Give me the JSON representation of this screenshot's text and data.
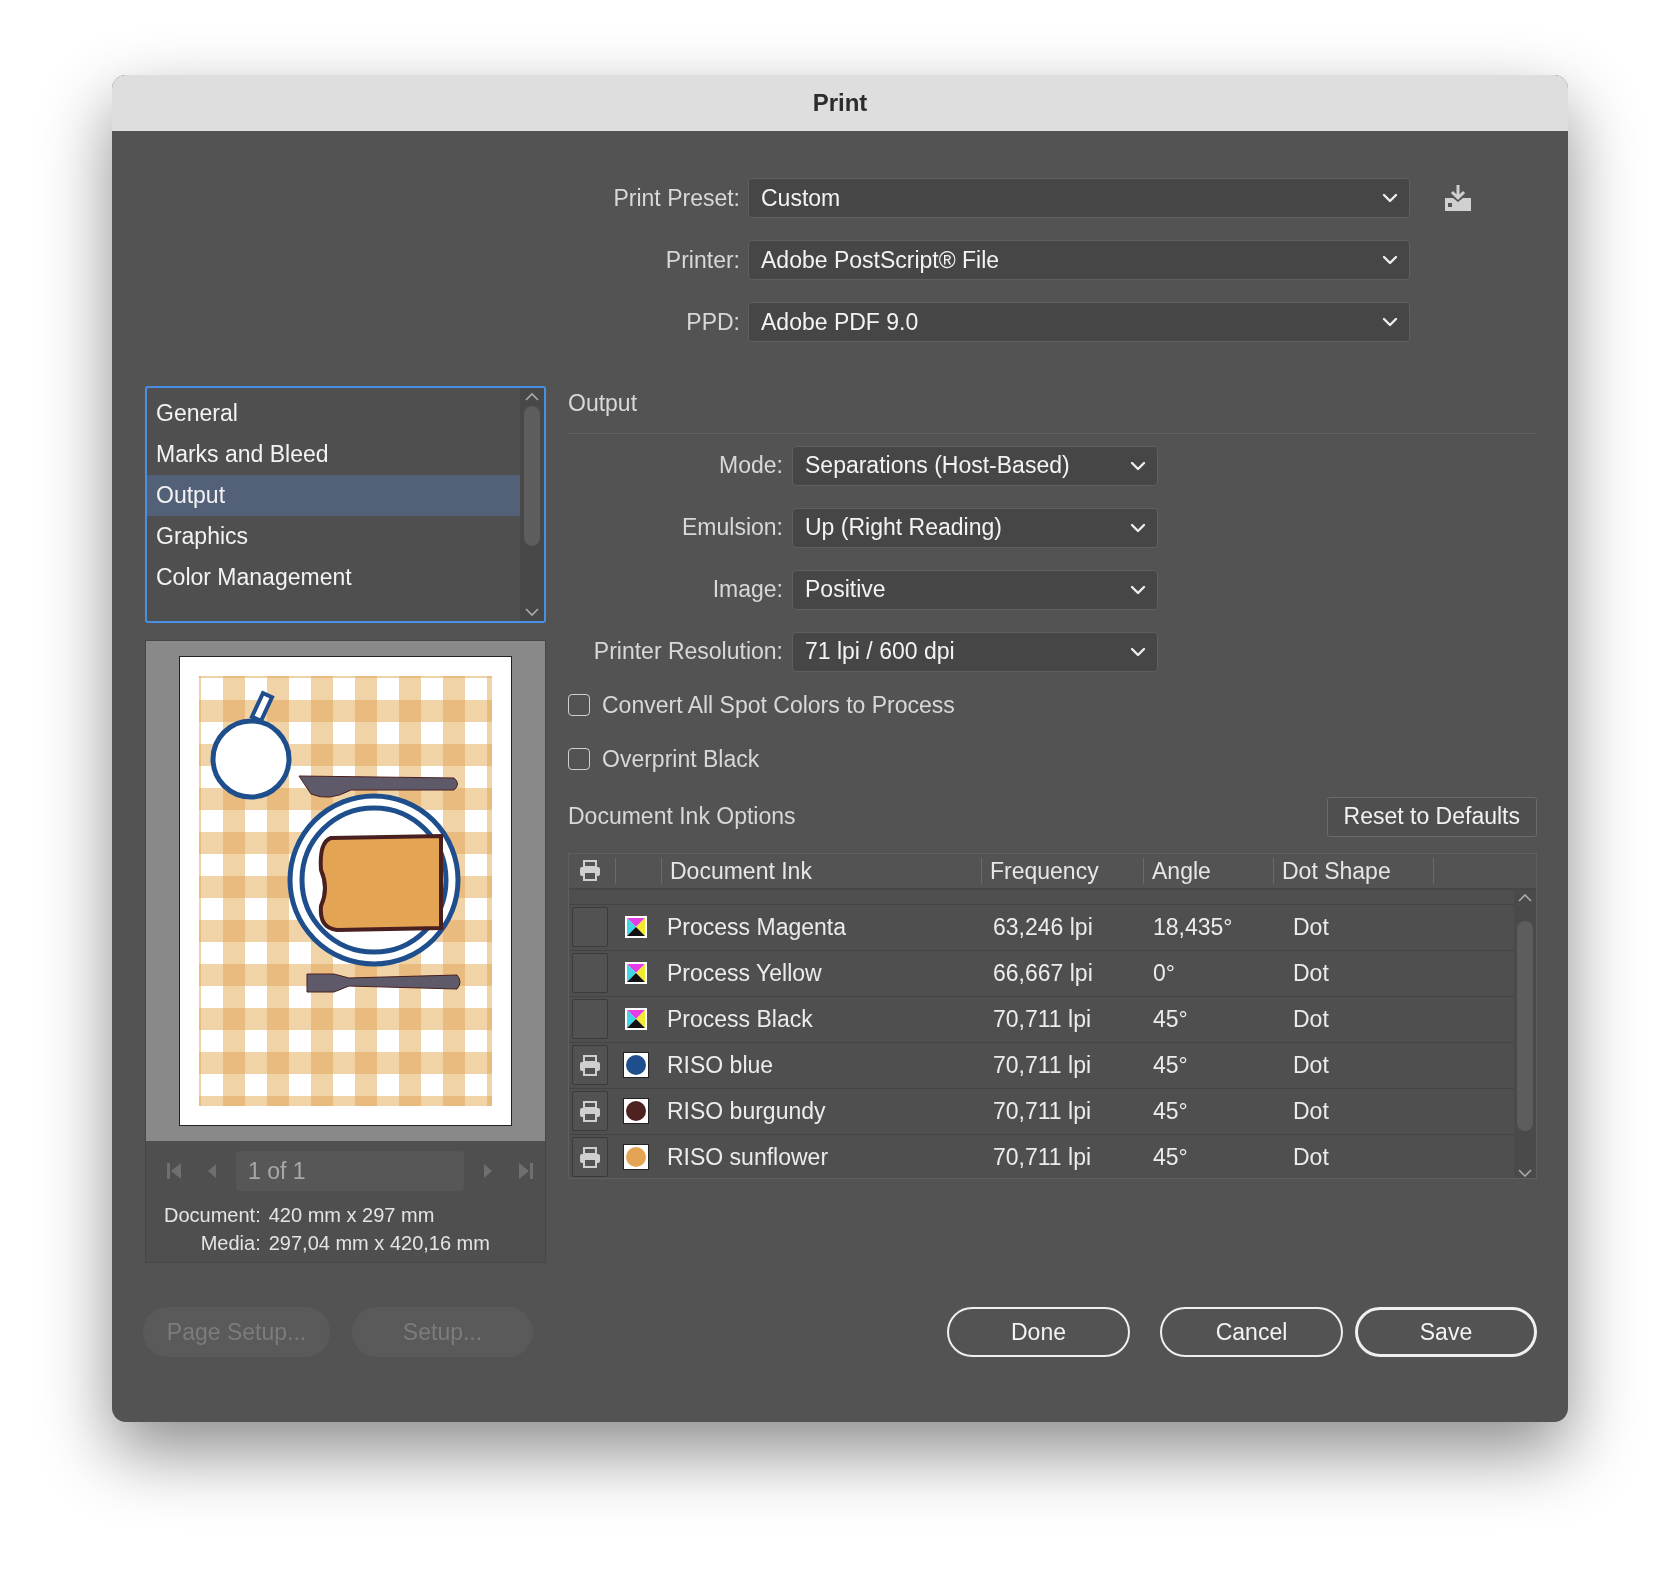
{
  "window": {
    "title": "Print"
  },
  "setup": [
    {
      "label": "Print Preset:",
      "value": "Custom"
    },
    {
      "label": "Printer:",
      "value": "Adobe PostScript® File"
    },
    {
      "label": "PPD:",
      "value": "Adobe PDF 9.0"
    }
  ],
  "sidebar": {
    "items": [
      {
        "label": "General",
        "selected": false
      },
      {
        "label": "Marks and Bleed",
        "selected": false
      },
      {
        "label": "Output",
        "selected": true
      },
      {
        "label": "Graphics",
        "selected": false
      },
      {
        "label": "Color Management",
        "selected": false
      }
    ]
  },
  "preview": {
    "page_field": {
      "value": "1 of 1",
      "disabled": true
    },
    "document_label": "Document:",
    "document_value": "420 mm x 297 mm",
    "media_label": "Media:",
    "media_value": "297,04 mm x 420,16 mm"
  },
  "output": {
    "heading": "Output",
    "fields": [
      {
        "label": "Mode:",
        "value": "Separations (Host-Based)"
      },
      {
        "label": "Emulsion:",
        "value": "Up (Right Reading)"
      },
      {
        "label": "Image:",
        "value": "Positive"
      },
      {
        "label": "Printer Resolution:",
        "value": "71 lpi / 600 dpi"
      }
    ],
    "checkboxes": [
      {
        "label": "Convert All Spot Colors to Process",
        "checked": false
      },
      {
        "label": "Overprint Black",
        "checked": false
      }
    ]
  },
  "ink_options": {
    "heading": "Document Ink Options",
    "reset_button": "Reset to Defaults",
    "columns": [
      "Document Ink",
      "Frequency",
      "Angle",
      "Dot Shape"
    ],
    "rows": [
      {
        "print": false,
        "kind": "process",
        "name": "Process Magenta",
        "frequency": "63,246 lpi",
        "angle": "18,435°",
        "dot_shape": "Dot"
      },
      {
        "print": false,
        "kind": "process",
        "name": "Process Yellow",
        "frequency": "66,667 lpi",
        "angle": "0°",
        "dot_shape": "Dot"
      },
      {
        "print": false,
        "kind": "process",
        "name": "Process Black",
        "frequency": "70,711 lpi",
        "angle": "45°",
        "dot_shape": "Dot"
      },
      {
        "print": true,
        "kind": "spot",
        "color": "#1f4e8c",
        "name": "RISO blue",
        "frequency": "70,711 lpi",
        "angle": "45°",
        "dot_shape": "Dot"
      },
      {
        "print": true,
        "kind": "spot",
        "color": "#4f2222",
        "name": "RISO burgundy",
        "frequency": "70,711 lpi",
        "angle": "45°",
        "dot_shape": "Dot"
      },
      {
        "print": true,
        "kind": "spot",
        "color": "#e3a554",
        "name": "RISO sunflower",
        "frequency": "70,711 lpi",
        "angle": "45°",
        "dot_shape": "Dot"
      }
    ]
  },
  "buttons": [
    {
      "label": "Page Setup...",
      "disabled": true,
      "default": false
    },
    {
      "label": "Setup...",
      "disabled": true,
      "default": false
    },
    {
      "label": "Done",
      "disabled": false,
      "default": false
    },
    {
      "label": "Cancel",
      "disabled": false,
      "default": false
    },
    {
      "label": "Save",
      "disabled": false,
      "default": true
    }
  ]
}
